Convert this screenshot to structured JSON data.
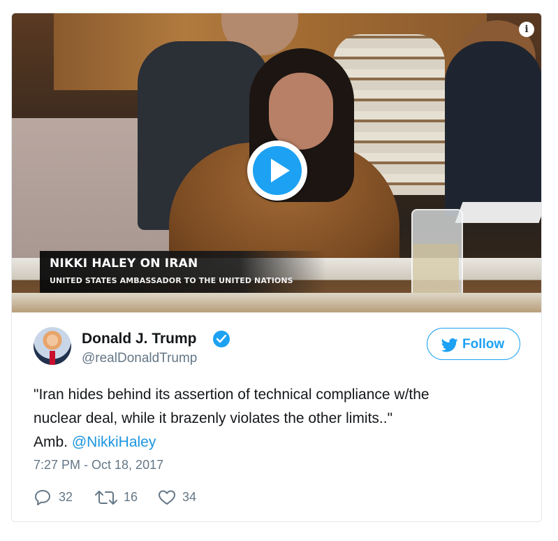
{
  "video": {
    "lower_third_title": "NIKKI HALEY ON IRAN",
    "lower_third_subtitle": "UNITED STATES AMBASSADOR TO THE UNITED NATIONS",
    "info_icon": "info-icon",
    "play_icon": "play-icon"
  },
  "author": {
    "name": "Donald J. Trump",
    "handle": "@realDonaldTrump",
    "verified_icon": "verified-badge-icon"
  },
  "follow_button": {
    "label": "Follow",
    "icon": "twitter-bird-icon"
  },
  "tweet": {
    "line1": "\"Iran hides behind its assertion of technical compliance w/the",
    "line2": "nuclear deal, while it brazenly violates the other limits..\"",
    "line3_prefix": "Amb.",
    "mention": "@NikkiHaley",
    "timestamp": "7:27 PM - Oct 18, 2017"
  },
  "actions": {
    "replies": "32",
    "retweets": "16",
    "likes": "34"
  },
  "colors": {
    "accent": "#1da1f2",
    "link": "#1b95e0",
    "muted_text": "#657786",
    "border": "#e1e8ed"
  }
}
